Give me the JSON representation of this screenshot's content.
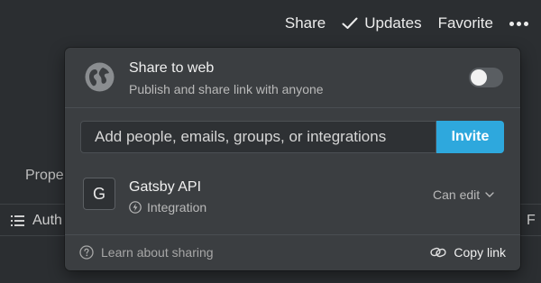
{
  "topbar": {
    "share": "Share",
    "updates": "Updates",
    "favorite": "Favorite"
  },
  "background": {
    "property_label": "Prope",
    "column_author": "Auth",
    "column_right": "F"
  },
  "share_popup": {
    "share_to_web": {
      "title": "Share to web",
      "subtitle": "Publish and share link with anyone",
      "toggle_on": false
    },
    "invite": {
      "placeholder": "Add people, emails, groups, or integrations",
      "button": "Invite"
    },
    "members": [
      {
        "avatar_letter": "G",
        "name": "Gatsby API",
        "type": "Integration",
        "permission": "Can edit"
      }
    ],
    "footer": {
      "learn": "Learn about sharing",
      "copy_link": "Copy link"
    }
  },
  "colors": {
    "accent": "#2ea8dd",
    "popup_bg": "#3b3e41",
    "page_bg": "#2b2e31"
  }
}
